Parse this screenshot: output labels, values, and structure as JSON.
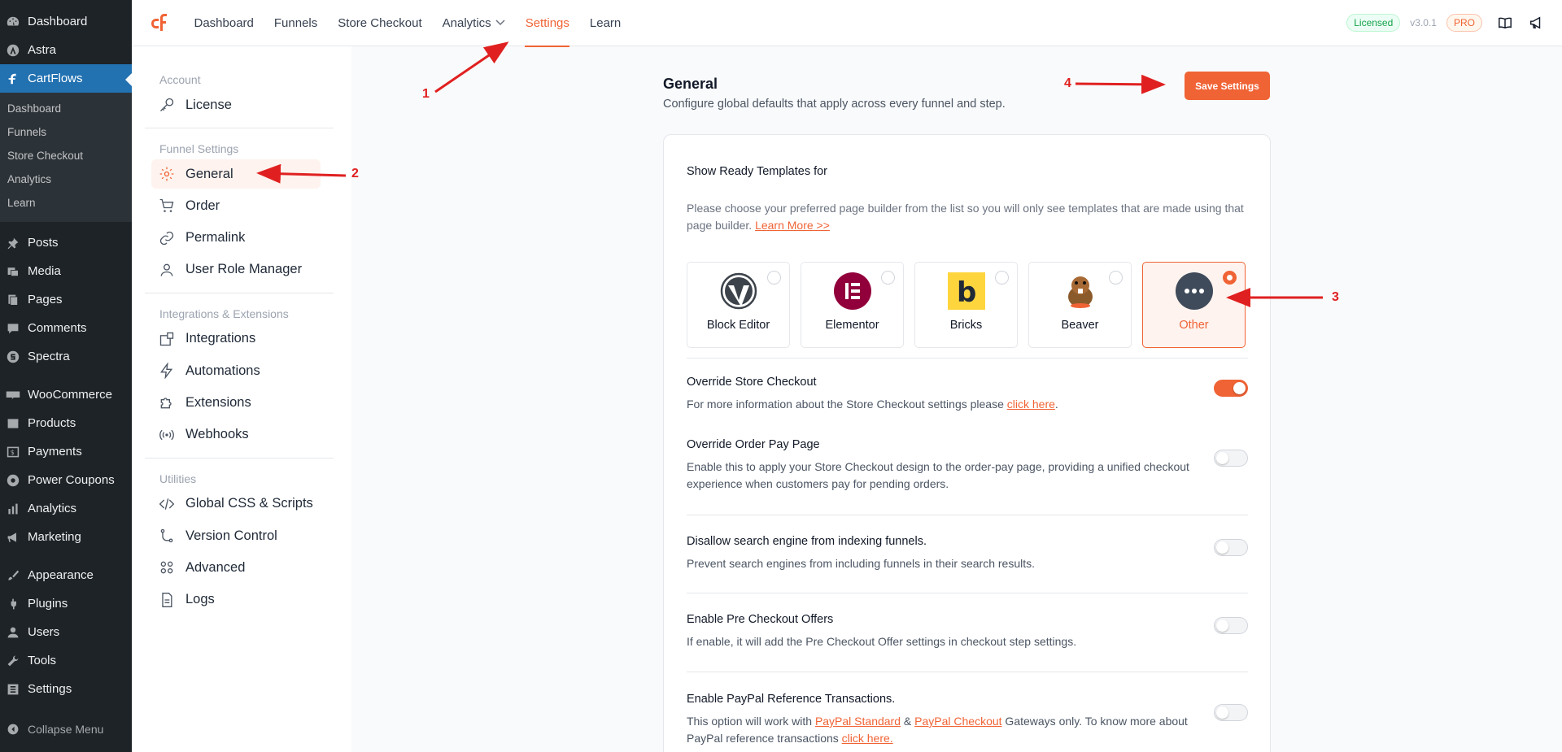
{
  "wp_sidebar": {
    "items_top": [
      {
        "label": "Dashboard",
        "icon": "dashboard-icon"
      },
      {
        "label": "Astra",
        "icon": "astra-icon"
      },
      {
        "label": "CartFlows",
        "icon": "cartflows-icon"
      }
    ],
    "submenu": [
      "Dashboard",
      "Funnels",
      "Store Checkout",
      "Analytics",
      "Learn"
    ],
    "items_mid": [
      {
        "label": "Posts"
      },
      {
        "label": "Media"
      },
      {
        "label": "Pages"
      },
      {
        "label": "Comments"
      },
      {
        "label": "Spectra"
      }
    ],
    "items_woo": [
      {
        "label": "WooCommerce"
      },
      {
        "label": "Products"
      },
      {
        "label": "Payments"
      },
      {
        "label": "Power Coupons"
      },
      {
        "label": "Analytics"
      },
      {
        "label": "Marketing"
      }
    ],
    "items_bottom": [
      {
        "label": "Appearance"
      },
      {
        "label": "Plugins"
      },
      {
        "label": "Users"
      },
      {
        "label": "Tools"
      },
      {
        "label": "Settings"
      }
    ],
    "collapse": "Collapse Menu"
  },
  "topbar": {
    "nav": [
      "Dashboard",
      "Funnels",
      "Store Checkout",
      "Analytics",
      "Settings",
      "Learn"
    ],
    "active": "Settings",
    "licensed": "Licensed",
    "version": "v3.0.1",
    "pro": "PRO"
  },
  "settings_nav": {
    "account_heading": "Account",
    "account_items": [
      "License"
    ],
    "funnel_heading": "Funnel Settings",
    "funnel_items": [
      "General",
      "Order",
      "Permalink",
      "User Role Manager"
    ],
    "integrations_heading": "Integrations & Extensions",
    "integrations_items": [
      "Integrations",
      "Automations",
      "Extensions",
      "Webhooks"
    ],
    "utilities_heading": "Utilities",
    "utilities_items": [
      "Global CSS & Scripts",
      "Version Control",
      "Advanced",
      "Logs"
    ]
  },
  "main": {
    "title": "General",
    "description": "Configure global defaults that apply across every funnel and step.",
    "save_label": "Save Settings",
    "templates": {
      "title": "Show Ready Templates for",
      "desc": "Please choose your preferred page builder from the list so you will only see templates that are made using that page builder.",
      "learn_more": "Learn More >>",
      "builders": [
        "Block Editor",
        "Elementor",
        "Bricks",
        "Beaver",
        "Other"
      ],
      "selected": "Other"
    },
    "settings": [
      {
        "title": "Override Store Checkout",
        "desc_pre": "For more information about the Store Checkout settings please ",
        "link": "click here",
        "desc_post": ".",
        "on": true
      },
      {
        "title": "Override Order Pay Page",
        "desc": "Enable this to apply your Store Checkout design to the order-pay page, providing a unified checkout experience when customers pay for pending orders.",
        "on": false
      },
      {
        "title": "Disallow search engine from indexing funnels.",
        "desc": "Prevent search engines from including funnels in their search results.",
        "on": false
      },
      {
        "title": "Enable Pre Checkout Offers",
        "desc": "If enable, it will add the Pre Checkout Offer settings in checkout step settings.",
        "on": false
      },
      {
        "title": "Enable PayPal Reference Transactions.",
        "desc_pre": "This option will work with ",
        "link1": "PayPal Standard",
        "amp": " & ",
        "link2": "PayPal Checkout",
        "desc_mid": " Gateways only. To know more about PayPal reference transactions ",
        "link3": "click here.",
        "on": false
      }
    ]
  },
  "annotations": [
    "1",
    "2",
    "3",
    "4"
  ],
  "colors": {
    "accent": "#f06335",
    "wp_blue": "#2271b1",
    "wp_dark": "#1d2327",
    "annotation_red": "#e02020"
  }
}
